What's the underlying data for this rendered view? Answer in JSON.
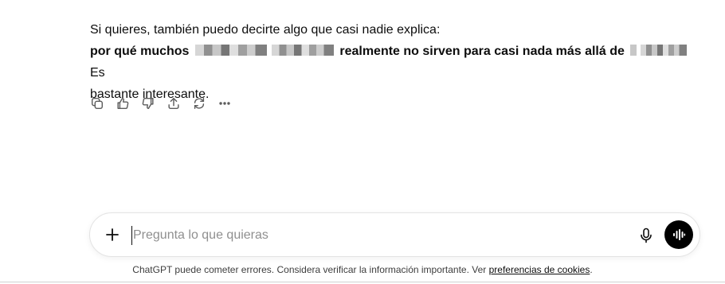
{
  "message": {
    "line1": "Si quieres, también puedo decirte algo que casi nadie explica:",
    "bold_prefix": "por qué muchos",
    "bold_middle": "realmente no sirven para casi nada más allá de",
    "trailing": "Es",
    "line3": "bastante interesante."
  },
  "actions": {
    "copy": "copy-icon",
    "like": "thumbs-up-icon",
    "dislike": "thumbs-down-icon",
    "share": "share-icon",
    "regenerate": "regenerate-icon",
    "more": "more-icon"
  },
  "composer": {
    "placeholder": "Pregunta lo que quieras",
    "value": ""
  },
  "footer": {
    "text": "ChatGPT puede cometer errores. Considera verificar la información importante. Ver",
    "link": "preferencias de cookies",
    "end": "."
  },
  "colors": {
    "accent": "#000000",
    "text": "#0d0d0d",
    "muted": "#5d5d5d",
    "placeholder": "#8f8f8f"
  }
}
